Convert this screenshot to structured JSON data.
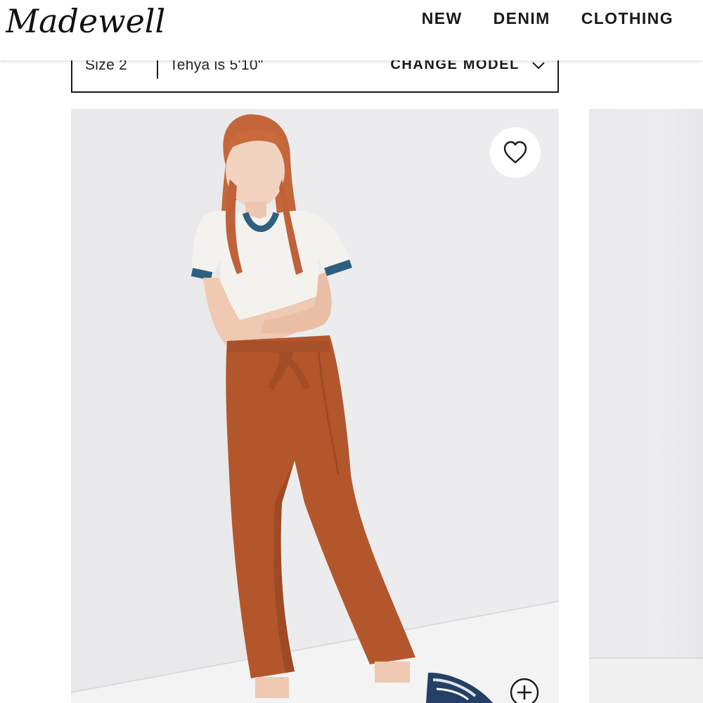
{
  "brand": {
    "logo_text": "Madewell"
  },
  "nav": {
    "items": [
      "NEW",
      "DENIM",
      "CLOTHING"
    ]
  },
  "model_selector": {
    "size_label": "Size 2",
    "model_text": "Tehya is 5'10\"",
    "change_label": "CHANGE MODEL",
    "chevron_icon": "chevron-down-icon"
  },
  "product": {
    "image_alt_subject": "model photo",
    "wishlist_icon": "heart-icon",
    "zoom_icon": "zoom-plus-icon",
    "colors": {
      "pants": "#b4562c",
      "tee": "#f4f2ee",
      "ringer_trim": "#2f5f80",
      "hair": "#c96a3c",
      "background": "#ebebed"
    }
  }
}
